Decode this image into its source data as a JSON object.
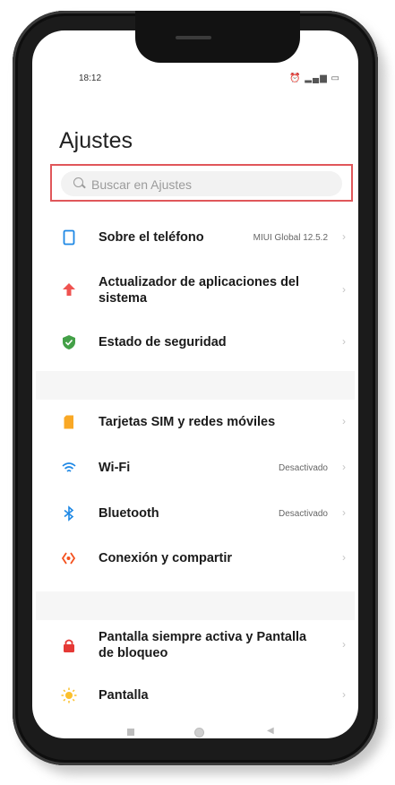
{
  "status_bar": {
    "time": "18:12",
    "right_icons": "⏰ ▂▄▆ ▭"
  },
  "page": {
    "title": "Ajustes"
  },
  "search": {
    "placeholder": "Buscar en Ajustes"
  },
  "section1": [
    {
      "label": "Sobre el teléfono",
      "value": "MIUI Global 12.5.2",
      "icon": "phone-icon",
      "color": "#1e88e5"
    },
    {
      "label": "Actualizador de aplicaciones del sistema",
      "value": "",
      "icon": "arrow-up-icon",
      "color": "#ef5350"
    },
    {
      "label": "Estado de seguridad",
      "value": "",
      "icon": "shield-icon",
      "color": "#43a047"
    }
  ],
  "section2": [
    {
      "label": "Tarjetas SIM y redes móviles",
      "value": "",
      "icon": "sim-icon",
      "color": "#f9a825"
    },
    {
      "label": "Wi-Fi",
      "value": "Desactivado",
      "icon": "wifi-icon",
      "color": "#1e88e5"
    },
    {
      "label": "Bluetooth",
      "value": "Desactivado",
      "icon": "bluetooth-icon",
      "color": "#1e88e5"
    },
    {
      "label": "Conexión y compartir",
      "value": "",
      "icon": "connection-icon",
      "color": "#f4511e"
    }
  ],
  "section3": [
    {
      "label": "Pantalla siempre activa y Pantalla de bloqueo",
      "value": "",
      "icon": "lock-icon",
      "color": "#e53935"
    },
    {
      "label": "Pantalla",
      "value": "",
      "icon": "sun-icon",
      "color": "#fbc02d"
    }
  ],
  "chevron": "›"
}
